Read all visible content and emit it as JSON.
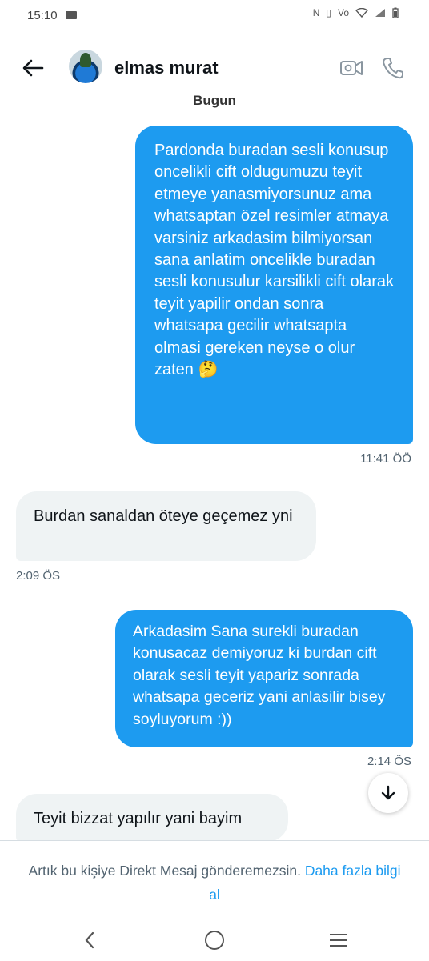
{
  "status_bar": {
    "time": "15:10",
    "icons": [
      "mail-icon",
      "nfc-icon",
      "vibrate-icon",
      "volte-icon",
      "wifi-icon",
      "signal-icon",
      "battery-icon"
    ]
  },
  "header": {
    "contact_name": "elmas murat"
  },
  "day_separator": "Bugun",
  "messages": [
    {
      "direction": "out",
      "text": "Pardonda buradan sesli konusup oncelikli cift oldugumuzu teyit etmeye yanasmiyorsunuz ama whatsaptan özel resimler atmaya varsiniz arkadasim bilmiyorsan sana anlatim oncelikle buradan sesli konusulur karsilikli cift  olarak teyit yapilir ondan sonra whatsapa gecilir whatsapta olmasi gereken neyse o olur zaten 🤔",
      "time": "11:41 ÖÖ"
    },
    {
      "direction": "in",
      "text": "Burdan sanaldan öteye geçemez yni",
      "time": "2:09 ÖS"
    },
    {
      "direction": "out",
      "text": "Arkadasim Sana surekli buradan konusacaz demiyoruz ki burdan cift olarak sesli teyit yapariz sonrada whatsapa geceriz yani anlasilir bisey soyluyorum :))",
      "time": "2:14 ÖS"
    },
    {
      "direction": "in",
      "text": "Teyit bizzat yapılır yani bayim",
      "time": ""
    }
  ],
  "footer": {
    "notice": "Artık bu kişiye Direkt Mesaj gönderemezsin.",
    "link": "Daha fazla bilgi al"
  },
  "colors": {
    "accent": "#1d9bf0",
    "incoming_bubble": "#eff3f4",
    "secondary_text": "#536471"
  }
}
